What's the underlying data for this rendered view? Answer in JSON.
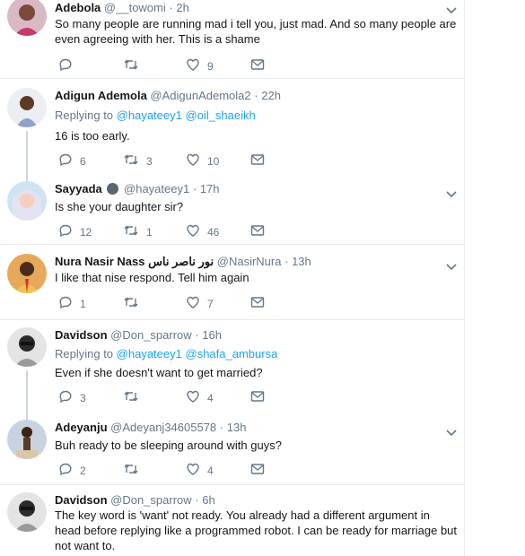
{
  "tweets": [
    {
      "name": "Adebola",
      "handle": "@__towomi",
      "time": "2h",
      "text": "So many people are running mad i tell you, just mad. And so many people are even agreeing with her. This is a shame",
      "replies": "",
      "retweets": "",
      "likes": "9"
    },
    {
      "name": "Adigun Ademola",
      "handle": "@AdigunAdemola2",
      "time": "22h",
      "replying_prefix": "Replying to",
      "replying_to": [
        "@hayateey1",
        "@oil_shaeikh"
      ],
      "text": "16 is too early.",
      "replies": "6",
      "retweets": "3",
      "likes": "10"
    },
    {
      "name": "Sayyada",
      "handle": "@hayateey1",
      "time": "17h",
      "text": "Is she your daughter sir?",
      "replies": "12",
      "retweets": "1",
      "likes": "46"
    },
    {
      "name": "Nura Nasir Nass نور ناصر ناس",
      "handle": "@NasirNura",
      "time": "13h",
      "text": "I like that nise respond. Tell him again",
      "replies": "1",
      "retweets": "",
      "likes": "7"
    },
    {
      "name": "Davidson",
      "handle": "@Don_sparrow",
      "time": "16h",
      "replying_prefix": "Replying to",
      "replying_to": [
        "@hayateey1",
        "@shafa_ambursa"
      ],
      "text": "Even if she doesn't want to get married?",
      "replies": "3",
      "retweets": "",
      "likes": "4"
    },
    {
      "name": "Adeyanju",
      "handle": "@Adeyanj34605578",
      "time": "13h",
      "text": "Buh ready to be sleeping around with guys?",
      "replies": "2",
      "retweets": "",
      "likes": "4"
    },
    {
      "name": "Davidson",
      "handle": "@Don_sparrow",
      "time": "6h",
      "text": "The key word is 'want' not ready. You already had a different argument in head before replying like a programmed robot. I can be ready for marriage but not want to.",
      "replies": "",
      "retweets": "",
      "likes": ""
    }
  ],
  "separator": "·",
  "colors": {
    "link": "#1da1f2",
    "muted": "#657786",
    "divider": "#e6ecf0",
    "thread": "#ccd6dd"
  },
  "icons": [
    "reply-icon",
    "retweet-icon",
    "like-icon",
    "dm-icon",
    "chevron-down-icon"
  ]
}
